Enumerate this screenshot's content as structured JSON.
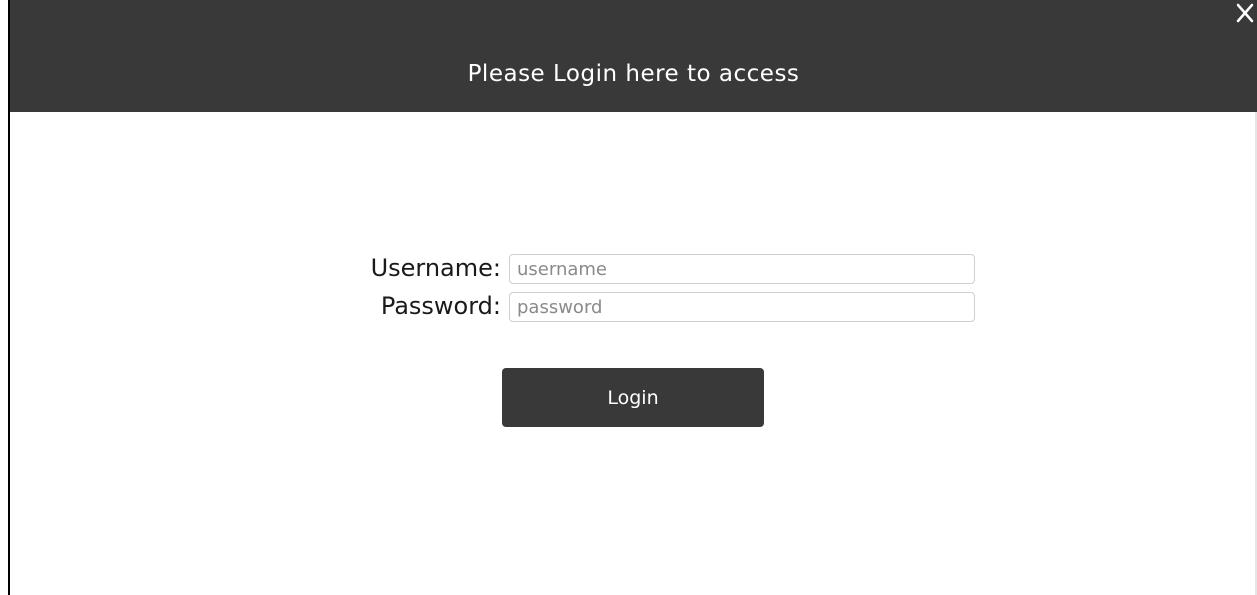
{
  "dialog": {
    "title": "Please Login here to access",
    "close_label": "X"
  },
  "form": {
    "username": {
      "label": "Username:",
      "placeholder": "username",
      "value": ""
    },
    "password": {
      "label": "Password:",
      "placeholder": "password",
      "value": ""
    },
    "login_button_label": "Login"
  },
  "colors": {
    "header_background": "#393939",
    "button_background": "#393939",
    "text_on_dark": "#ffffff"
  },
  "icons": {
    "close": "close-icon"
  }
}
